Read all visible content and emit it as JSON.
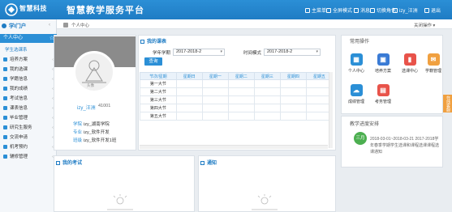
{
  "brand": {
    "logo_text": "智慧科技",
    "app_title": "智慧教学服务平台"
  },
  "topnav": [
    {
      "label": "主菜单",
      "icon": "menu-icon"
    },
    {
      "label": "全屏模式",
      "icon": "fullscreen-icon"
    },
    {
      "label": "消息",
      "icon": "bell-icon"
    },
    {
      "label": "切换角色",
      "icon": "switch-role-icon"
    },
    {
      "label": "izy_汪洲",
      "icon": "user-icon"
    },
    {
      "label": "退出",
      "icon": "logout-icon"
    }
  ],
  "sidebar": {
    "title": "学I门户",
    "active": "个人中心",
    "sub": "学生选课系",
    "items": [
      "培养方案",
      "我的选课",
      "学籍信息",
      "我的成绩",
      "考试信息",
      "课表信息",
      "毕业管理",
      "研究生服务",
      "交流申请",
      "机考预约",
      "辅修管理"
    ]
  },
  "breadcrumb": {
    "tab": "个人中心",
    "close_all": "关闭操作"
  },
  "profile": {
    "avatar_caption": "头像",
    "name": "izy_汪洲",
    "id": "41001",
    "college_key": "学院",
    "college": "izy_湖南学院",
    "major_key": "专业",
    "major": "izy_软件开发",
    "class_key": "班级",
    "class": "izy_软件开发1班"
  },
  "schedule": {
    "title": "我的课表",
    "term_label": "学年学期",
    "term_value": "2017-2018-2",
    "time_label": "时间模式",
    "time_value": "2017-2018-2",
    "query_label": "查询",
    "columns": [
      "节次/星期",
      "星期日",
      "星期一",
      "星期二",
      "星期三",
      "星期四",
      "星期五"
    ],
    "rows": [
      "第一大节",
      "第二大节",
      "第三大节",
      "第四大节",
      "第五大节"
    ]
  },
  "common_ops": {
    "title": "常用操作",
    "items": [
      {
        "label": "个人中心",
        "color": "#2b8fd6",
        "icon": "grid-icon",
        "glyph": "▦"
      },
      {
        "label": "培养方案",
        "color": "#3a7bd5",
        "icon": "image-icon",
        "glyph": "▣"
      },
      {
        "label": "选课中心",
        "color": "#e8534a",
        "icon": "bookmark-icon",
        "glyph": "▮"
      },
      {
        "label": "学籍管理",
        "color": "#f0a040",
        "icon": "mail-icon",
        "glyph": "✉"
      },
      {
        "label": "成绩管理",
        "color": "#2b8fd6",
        "icon": "upload-cloud-icon",
        "glyph": "☁"
      },
      {
        "label": "考务管理",
        "color": "#e8534a",
        "icon": "clipboard-icon",
        "glyph": "▤"
      }
    ]
  },
  "notice": {
    "title": "教学进度安排",
    "badge": "三月",
    "text": "2018-03-01~2018-03-21 2017-2018学年春季学期学生选课和课程选课课程选课通知"
  },
  "bottom_panels": {
    "exam_title": "我的考试",
    "notice_title": "通知"
  },
  "feedback": "在线客服"
}
